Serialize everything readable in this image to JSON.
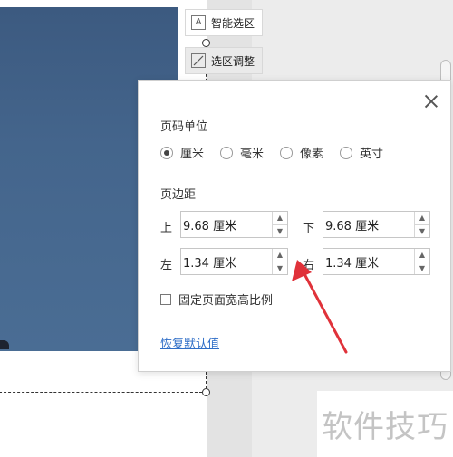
{
  "toolbar": {
    "smart_select_label": "智能选区",
    "adjust_select_label": "选区调整"
  },
  "dialog": {
    "page_unit_title": "页码单位",
    "units": [
      "厘米",
      "毫米",
      "像素",
      "英寸"
    ],
    "selected_unit": "厘米",
    "margin_title": "页边距",
    "top_label": "上",
    "top_value": "9.68 厘米",
    "bottom_label": "下",
    "bottom_value": "9.68 厘米",
    "left_label": "左",
    "left_value": "1.34 厘米",
    "right_label": "右",
    "right_value": "1.34 厘米",
    "lock_ratio_label": "固定页面宽高比例",
    "reset_label": "恢复默认值"
  },
  "watermark": "软件技巧",
  "colors": {
    "link": "#2f6ec7",
    "annotation_arrow": "#e0323a",
    "photo": "#44658c"
  }
}
